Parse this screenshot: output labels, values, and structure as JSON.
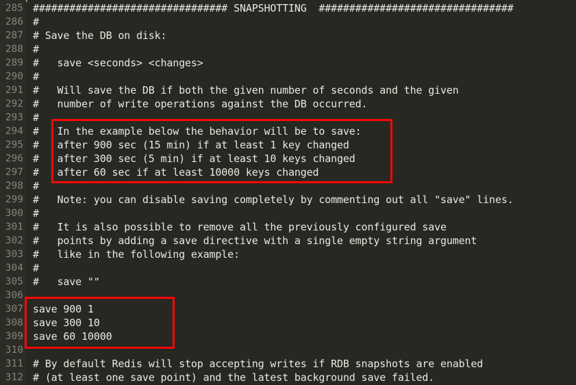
{
  "editor": {
    "theme_background": "#272822",
    "gutter_background": "#2b2c26",
    "text_color": "#e9e9e2",
    "lineno_color": "#85857b",
    "highlight_color": "#fa0808",
    "first_line_number": 285,
    "last_line_number": 312
  },
  "lines": [
    {
      "number": "285",
      "text": "################################ SNAPSHOTTING  ################################"
    },
    {
      "number": "286",
      "text": "#"
    },
    {
      "number": "287",
      "text": "# Save the DB on disk:"
    },
    {
      "number": "288",
      "text": "#"
    },
    {
      "number": "289",
      "text": "#   save <seconds> <changes>"
    },
    {
      "number": "290",
      "text": "#"
    },
    {
      "number": "291",
      "text": "#   Will save the DB if both the given number of seconds and the given"
    },
    {
      "number": "292",
      "text": "#   number of write operations against the DB occurred."
    },
    {
      "number": "293",
      "text": "#"
    },
    {
      "number": "294",
      "text": "#   In the example below the behavior will be to save:"
    },
    {
      "number": "295",
      "text": "#   after 900 sec (15 min) if at least 1 key changed"
    },
    {
      "number": "296",
      "text": "#   after 300 sec (5 min) if at least 10 keys changed"
    },
    {
      "number": "297",
      "text": "#   after 60 sec if at least 10000 keys changed"
    },
    {
      "number": "298",
      "text": "#"
    },
    {
      "number": "299",
      "text": "#   Note: you can disable saving completely by commenting out all \"save\" lines."
    },
    {
      "number": "300",
      "text": "#"
    },
    {
      "number": "301",
      "text": "#   It is also possible to remove all the previously configured save"
    },
    {
      "number": "302",
      "text": "#   points by adding a save directive with a single empty string argument"
    },
    {
      "number": "303",
      "text": "#   like in the following example:"
    },
    {
      "number": "304",
      "text": "#"
    },
    {
      "number": "305",
      "text": "#   save \"\""
    },
    {
      "number": "306",
      "text": ""
    },
    {
      "number": "307",
      "text": "save 900 1"
    },
    {
      "number": "308",
      "text": "save 300 10"
    },
    {
      "number": "309",
      "text": "save 60 10000"
    },
    {
      "number": "310",
      "text": ""
    },
    {
      "number": "311",
      "text": "# By default Redis will stop accepting writes if RDB snapshots are enabled"
    },
    {
      "number": "312",
      "text": "# (at least one save point) and the latest background save failed."
    }
  ],
  "annotations": [
    {
      "id": "example-behavior-box",
      "label": "red rectangle around save example comment lines 294-297",
      "covers_lines": [
        "294",
        "295",
        "296",
        "297"
      ],
      "color": "#fa0808"
    },
    {
      "id": "save-directives-box",
      "label": "red rectangle around active save directives lines 307-309",
      "covers_lines": [
        "307",
        "308",
        "309"
      ],
      "color": "#fa0808"
    }
  ]
}
